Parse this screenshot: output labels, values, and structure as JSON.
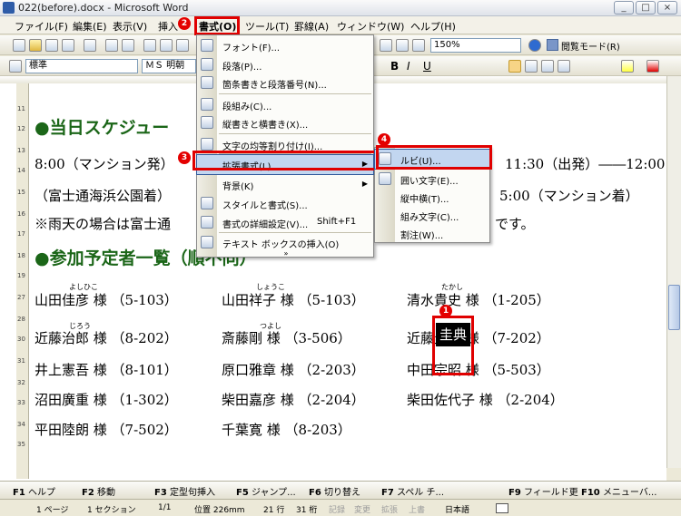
{
  "window": {
    "title": "022(before).docx - Microsoft Word",
    "buttons": [
      "_",
      "□",
      "×"
    ]
  },
  "menubar": [
    {
      "label": "ファイル(F)"
    },
    {
      "label": "編集(E)"
    },
    {
      "label": "表示(V)"
    },
    {
      "label": "挿入"
    },
    {
      "label": "書式(O)"
    },
    {
      "label": "ツール(T)"
    },
    {
      "label": "罫線(A)"
    },
    {
      "label": "ウィンドウ(W)"
    },
    {
      "label": "ヘルプ(H)"
    }
  ],
  "toolbar": {
    "zoom": "150%",
    "reading_mode": "閲覧モード(R)",
    "style": "標準",
    "font": "ＭＳ 明朝"
  },
  "doc": {
    "heading1": "●当日スケジュー",
    "line1a": "8:00（マンション発）",
    "line1b": "11:30（出発）――12:00",
    "line2a": "（富士通海浜公園着）",
    "line2b": "5:00（マンション着）",
    "line3a": "※雨天の場合は富士通",
    "line3b": "です。",
    "heading2": "●参加予定者一覧（順不同）",
    "rows": [
      [
        "山田佳彦 様 （5-103）",
        "山田祥子 様 （5-103）",
        "清水貴史 様 （1-205）"
      ],
      [
        "近藤治郎 様 （8-202）",
        "斎藤剛 様 （3-506）",
        "近藤圭典 様 （7-202）"
      ],
      [
        "井上憲吾 様 （8-101）",
        "原口雅章 様 （2-203）",
        "中田宗昭 様 （5-503）"
      ],
      [
        "沼田廣重 様 （1-302）",
        "柴田嘉彦 様 （2-204）",
        "柴田佐代子 様 （2-204）"
      ],
      [
        "平田陸朗 様 （7-502）",
        "千葉寛 様 （8-203）"
      ]
    ],
    "ruby": [
      "よしひこ",
      "しょうこ",
      "たかし",
      "じろう",
      "つよし"
    ],
    "selected_text": "圭典"
  },
  "format_menu": [
    {
      "label": "フォント(F)...",
      "icon": "font-icon"
    },
    {
      "label": "段落(P)...",
      "icon": "paragraph-icon"
    },
    {
      "label": "箇条書きと段落番号(N)...",
      "icon": "bullets-icon"
    },
    {
      "label": "段組み(C)...",
      "icon": "columns-icon"
    },
    {
      "label": "縦書きと横書き(X)...",
      "icon": "text-direction-icon"
    },
    {
      "label": "文字の均等割り付け(I)...",
      "icon": "distribute-icon"
    },
    {
      "label": "拡張書式(L)",
      "icon": "",
      "arrow": "▶"
    },
    {
      "label": "背景(K)",
      "icon": "",
      "arrow": "▶"
    },
    {
      "label": "スタイルと書式(S)...",
      "icon": "styles-icon"
    },
    {
      "label": "書式の詳細設定(V)...",
      "shortcut": "Shift+F1",
      "icon": "reveal-format-icon"
    },
    {
      "label": "テキスト ボックスの挿入(O)",
      "icon": "textbox-icon"
    }
  ],
  "submenu": [
    {
      "label": "ルビ(U)...",
      "icon": "ruby-icon"
    },
    {
      "label": "囲い文字(E)...",
      "icon": "enclose-icon"
    },
    {
      "label": "縦中横(T)...",
      "icon": "tate-chu-yoko-icon"
    },
    {
      "label": "組み文字(C)...",
      "icon": "combine-icon"
    },
    {
      "label": "割注(W)...",
      "icon": ""
    }
  ],
  "badges": [
    "1",
    "2",
    "3",
    "4"
  ],
  "fkeys": [
    {
      "key": "F1",
      "label": "ヘルプ"
    },
    {
      "key": "F2",
      "label": "移動"
    },
    {
      "key": "F3",
      "label": "定型句挿入"
    },
    {
      "key": "F5",
      "label": "ジャンプ..."
    },
    {
      "key": "F6",
      "label": "切り替え"
    },
    {
      "key": "F7",
      "label": "スペル チ..."
    },
    {
      "key": "F9",
      "label": "フィールド更"
    },
    {
      "key": "F10",
      "label": "メニューバ..."
    }
  ],
  "status": {
    "page": "1 ページ",
    "section": "1 セクション",
    "pages": "1/1",
    "position": "位置 226mm",
    "line": "21 行",
    "col": "31 桁",
    "rec": "記録",
    "trk": "変更",
    "ext": "拡張",
    "ovr": "上書",
    "lang": "日本語"
  },
  "colors": {
    "heading": "#1b6618",
    "highlight": "#e00000",
    "menu_hover": "#c2d6f0"
  }
}
